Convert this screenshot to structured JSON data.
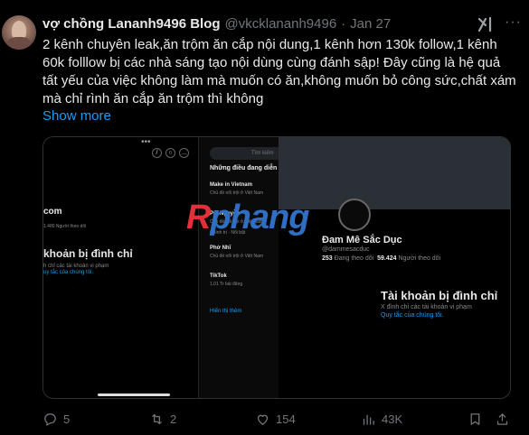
{
  "post": {
    "author_name": "vợ chồng Lananh9496 Blog",
    "handle": "@vkcklananh9496",
    "separator": "·",
    "date": "Jan 27",
    "more_glyph": "···",
    "text": "2 kênh chuyên leak,ăn trộm ăn cắp nội dung,1 kênh hơn 130k follow,1 kênh 60k folllow bị các nhà sáng tạo nội dùng cùng đánh sập! Đây cũng là hệ quả tất yếu của việc không làm mà muốn có ăn,không muốn bỏ công sức,chất xám mà chỉ rình ăn cắp ăn trộm thì không",
    "show_more": "Show more"
  },
  "media": {
    "left": {
      "dots": "•••",
      "com_label": "com",
      "follow_line": "1.480 Người theo dõi",
      "title": "khoản bị đình chỉ",
      "sub": "h chỉ các tài khoản vi phạm",
      "link": "uy tắc của chúng tôi."
    },
    "middle": {
      "search_placeholder": "Tìm kiếm",
      "header": "Những điều đang diễn r",
      "items": [
        {
          "title": "Make in Vietnam",
          "sub": "Chủ đề nổi trội ở Việt Nam"
        },
        {
          "title": "Pet Nguyễn",
          "sub": "Chủ đề nổi trội ở Việt Nam"
        },
        {
          "title": "",
          "sub": "Chính trị · Nổi bật"
        },
        {
          "title": "Phở Nhĩ",
          "sub": "Chủ đề nổi trội ở Việt Nam"
        },
        {
          "title": "TikTok",
          "sub": "1,01 Tr bài đăng"
        }
      ],
      "more_link": "Hiển thị thêm"
    },
    "right": {
      "name": "Đam Mê Sắc Dục",
      "handle": "@dammesacduc",
      "following_count": "253",
      "following_label": "Đang theo dõi",
      "followers_count": "59.424",
      "followers_label": "Người theo dõi",
      "title": "Tài khoản bị đình chỉ",
      "sub": "X đình chỉ các tài khoản vi phạm",
      "link": "Quy tắc của chúng tôi."
    },
    "watermark_r": "R",
    "watermark_rest": "phang"
  },
  "actions": {
    "replies": "5",
    "reposts": "2",
    "likes": "154",
    "views": "43K"
  },
  "colors": {
    "accent": "#1d9bf0",
    "muted": "#71767b",
    "bg": "#000000"
  }
}
